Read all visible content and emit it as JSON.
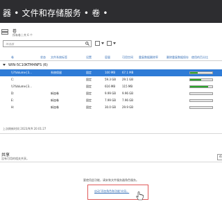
{
  "window": {
    "title": "器 • 文件和存储服务 • 卷 •"
  },
  "volumes_section": {
    "title": "卷",
    "subtitle": "所有卷 | 共 6 个"
  },
  "toolbar": {
    "filter_placeholder": "筛选器"
  },
  "columns": [
    "卷",
    "状态",
    "文件系统标签",
    "设置",
    "容量",
    "可用空间",
    "重复数据删除率",
    "删除重复数据保存",
    "使用的百分比"
  ],
  "group": {
    "label": "WIN-5C10KTM4NFS (6)"
  },
  "rows": [
    {
      "volume": "\\\\?\\Volume{3...",
      "status": "",
      "label": "系统保留",
      "setting": "固定",
      "capacity": "100 MB",
      "free": "67.1 MB",
      "used_pct": 33,
      "selected": true
    },
    {
      "volume": "C:",
      "status": "",
      "label": "",
      "setting": "固定",
      "capacity": "59.3 GB",
      "free": "29.1 GB",
      "used_pct": 51,
      "selected": false
    },
    {
      "volume": "\\\\?\\Volume{3...",
      "status": "",
      "label": "",
      "setting": "固定",
      "capacity": "616 MB",
      "free": "115 MB",
      "used_pct": 81,
      "selected": false
    },
    {
      "volume": "D:",
      "status": "",
      "label": "新加卷",
      "setting": "固定",
      "capacity": "9.99 GB",
      "free": "9.96 GB",
      "used_pct": 0,
      "selected": false
    },
    {
      "volume": "E:",
      "status": "",
      "label": "新加卷",
      "setting": "固定",
      "capacity": "7.99 GB",
      "free": "7.96 GB",
      "used_pct": 0,
      "selected": false
    },
    {
      "volume": "H:",
      "status": "",
      "label": "新加卷",
      "setting": "固定",
      "capacity": "30.0 GB",
      "free": "29.9 GB",
      "used_pct": 0,
      "selected": false
    }
  ],
  "last_refresh": "上次刷新时间 2023/9/9 20:01:27",
  "shares": {
    "title": "共享",
    "subtitle": "没有可用的相关共享。",
    "tasks_label": "任",
    "empty_message": "要使用此功能，请安装文件服务器角色服务。",
    "link_text": "启动'添加角色和功能'向导。"
  },
  "colors": {
    "titlebar": "#2d2d30",
    "selection": "#2e7bd6",
    "link": "#3b73b9",
    "usage_bar": "#2aa52a",
    "highlight_box": "#e05a5a"
  }
}
